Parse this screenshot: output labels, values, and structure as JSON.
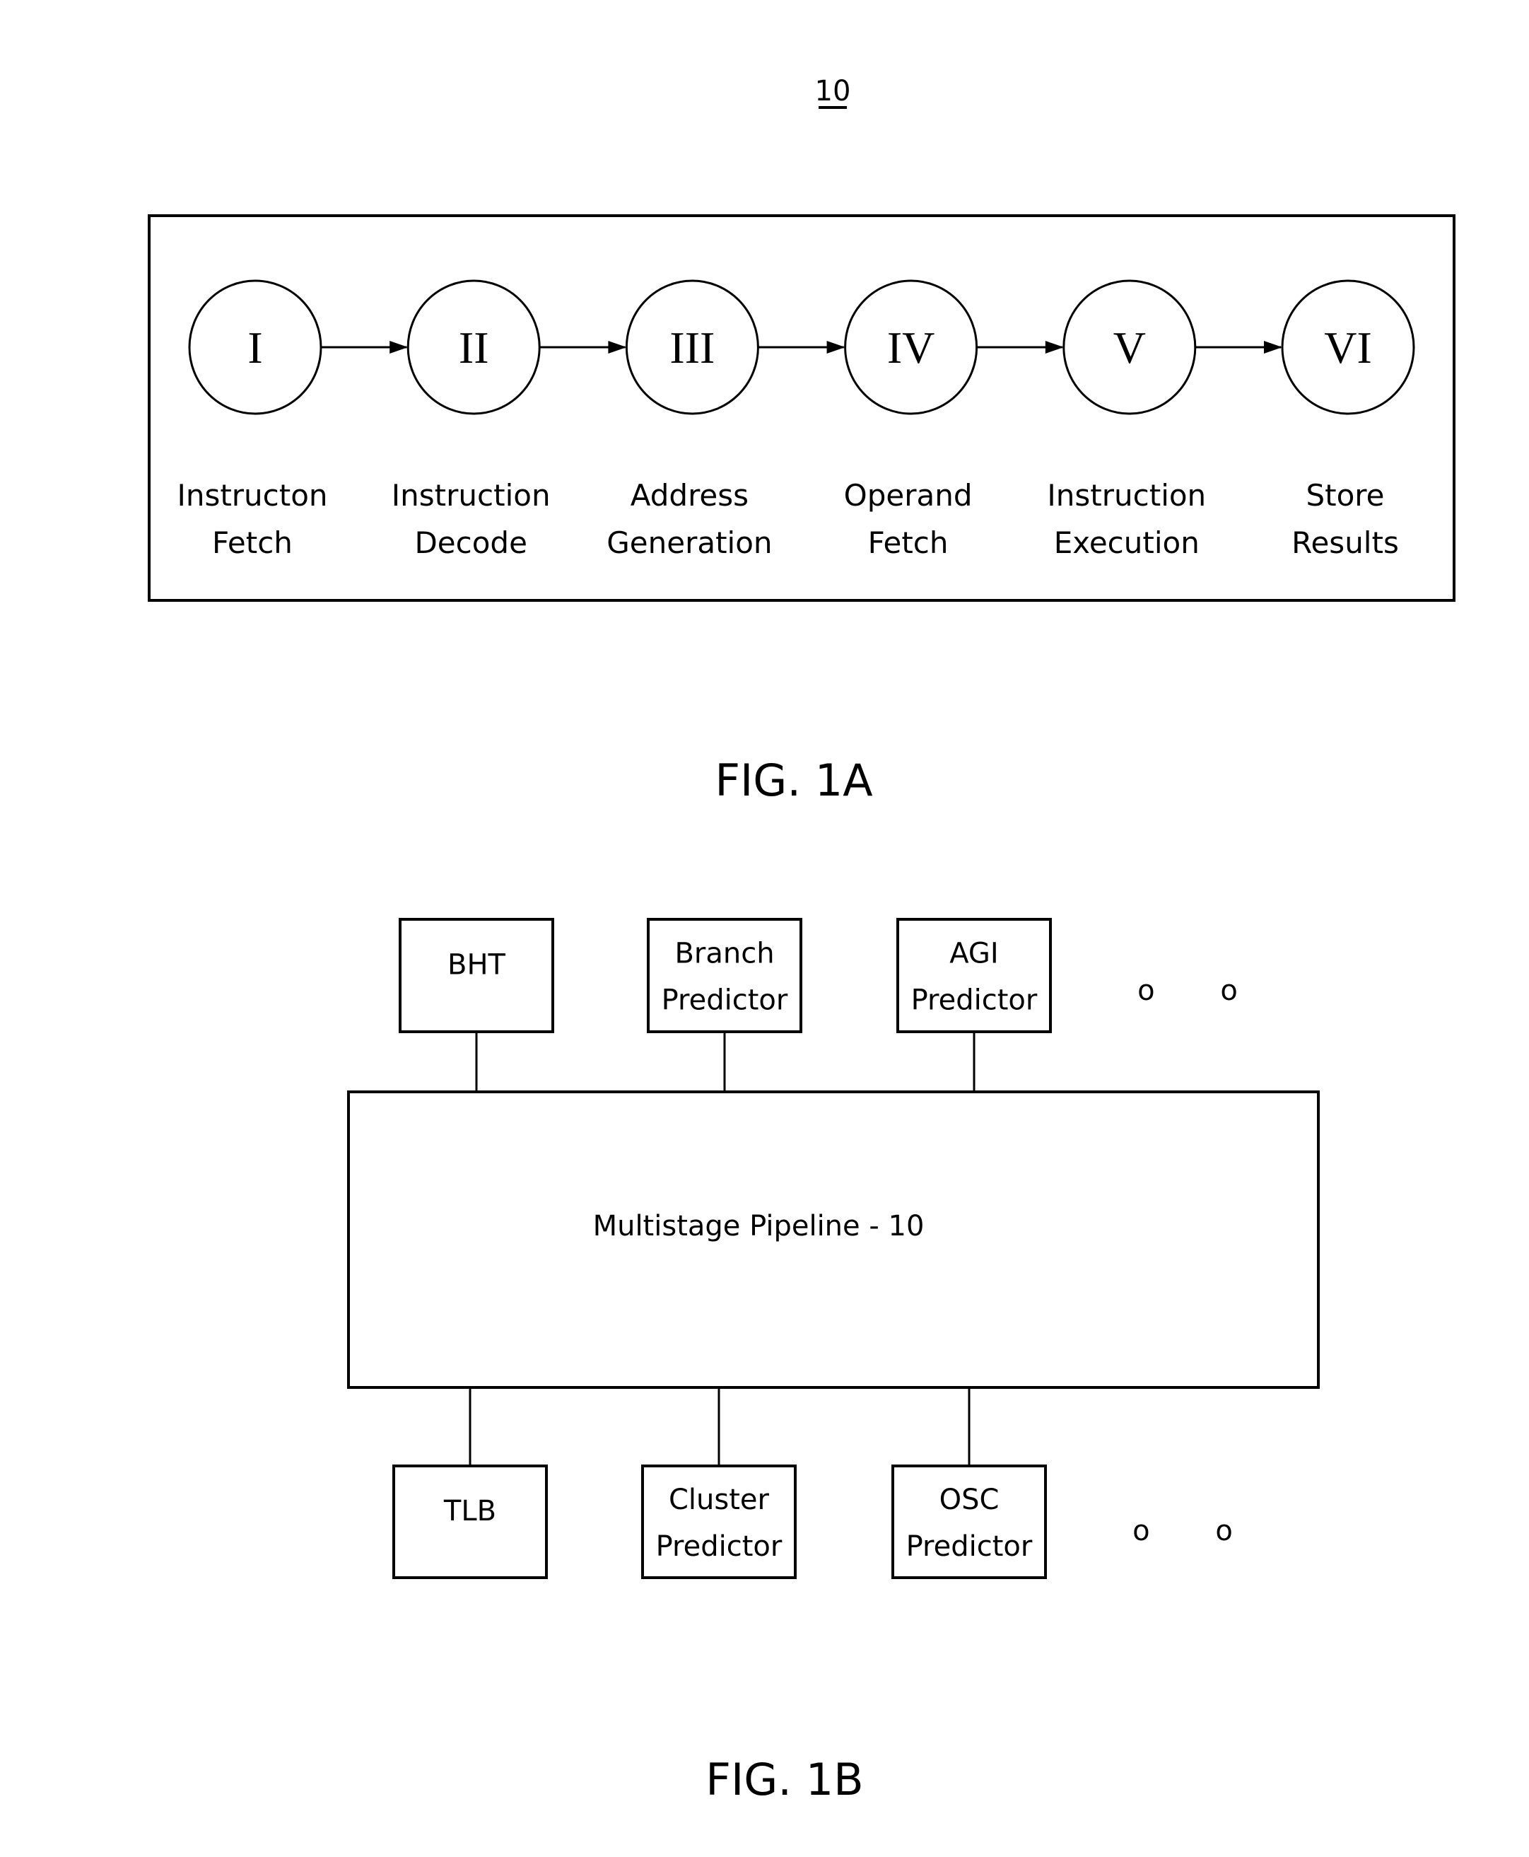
{
  "page_ref": "10",
  "fig1a": {
    "caption": "FIG. 1A",
    "stages": [
      {
        "numeral": "I",
        "line1": "Instructon",
        "line2": "Fetch"
      },
      {
        "numeral": "II",
        "line1": "Instruction",
        "line2": "Decode"
      },
      {
        "numeral": "III",
        "line1": "Address",
        "line2": "Generation"
      },
      {
        "numeral": "IV",
        "line1": "Operand",
        "line2": "Fetch"
      },
      {
        "numeral": "V",
        "line1": "Instruction",
        "line2": "Execution"
      },
      {
        "numeral": "VI",
        "line1": "Store",
        "line2": "Results"
      }
    ]
  },
  "fig1b": {
    "caption": "FIG. 1B",
    "pipeline_label": "Multistage Pipeline - 10",
    "top_units": [
      {
        "line1": "BHT",
        "line2": ""
      },
      {
        "line1": "Branch",
        "line2": "Predictor"
      },
      {
        "line1": "AGI",
        "line2": "Predictor"
      }
    ],
    "bottom_units": [
      {
        "line1": "TLB",
        "line2": ""
      },
      {
        "line1": "Cluster",
        "line2": "Predictor"
      },
      {
        "line1": "OSC",
        "line2": "Predictor"
      }
    ],
    "ellipsis_marks": "o o"
  }
}
